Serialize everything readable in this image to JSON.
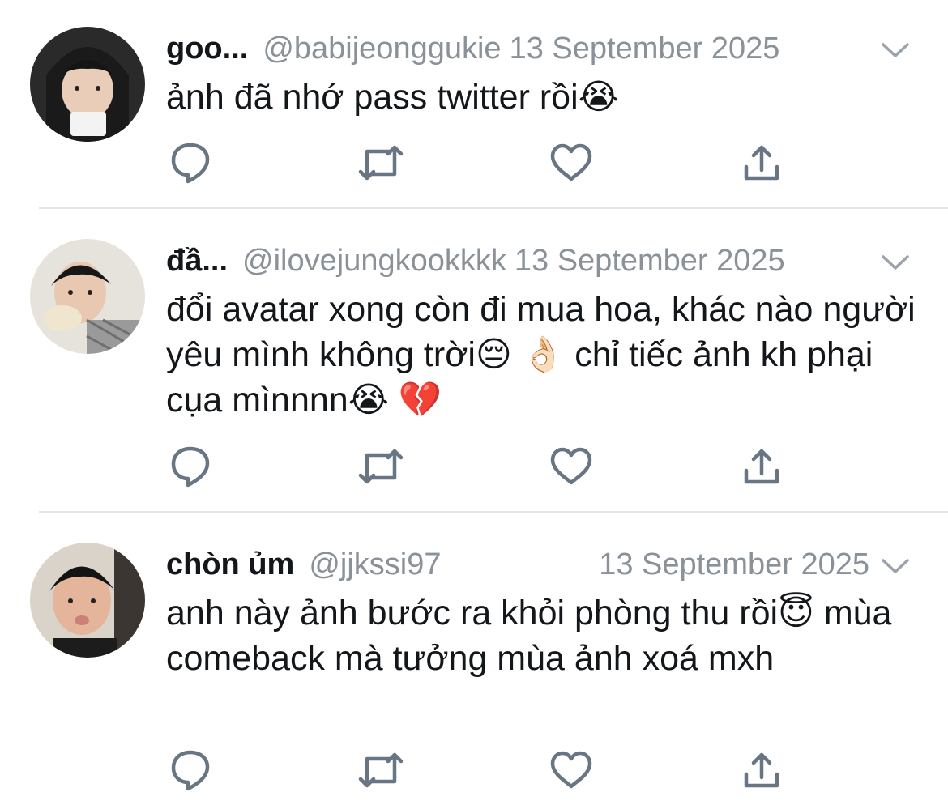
{
  "tweets": [
    {
      "name": "goo...",
      "handle": "@babijeonggukie",
      "date": "13 September 2025",
      "text": "ảnh đã nhớ pass twitter rồi😭"
    },
    {
      "name": "đầ...",
      "handle": "@ilovejungkookkkk",
      "date": "13 September 2025",
      "text": "đổi avatar xong còn đi mua hoa, khác nào người yêu mình không trời😔 👌🏻 chỉ tiếc ảnh kh phại cụa mìnnnn😭 💔"
    },
    {
      "name": "chòn ủm",
      "handle": "@jjkssi97",
      "date": "13 September 2025",
      "text": "anh này ảnh bước ra khỏi phòng thu rồi😇 mùa comeback mà tưởng mùa ảnh xoá mxh"
    }
  ],
  "icons": {
    "reply": "reply-icon",
    "retweet": "retweet-icon",
    "like": "heart-icon",
    "share": "share-icon",
    "menu": "chevron-down-icon"
  },
  "colors": {
    "icon": "#687684",
    "muted": "#8a9199",
    "text": "#14171a",
    "divider": "#e1e5e9"
  }
}
